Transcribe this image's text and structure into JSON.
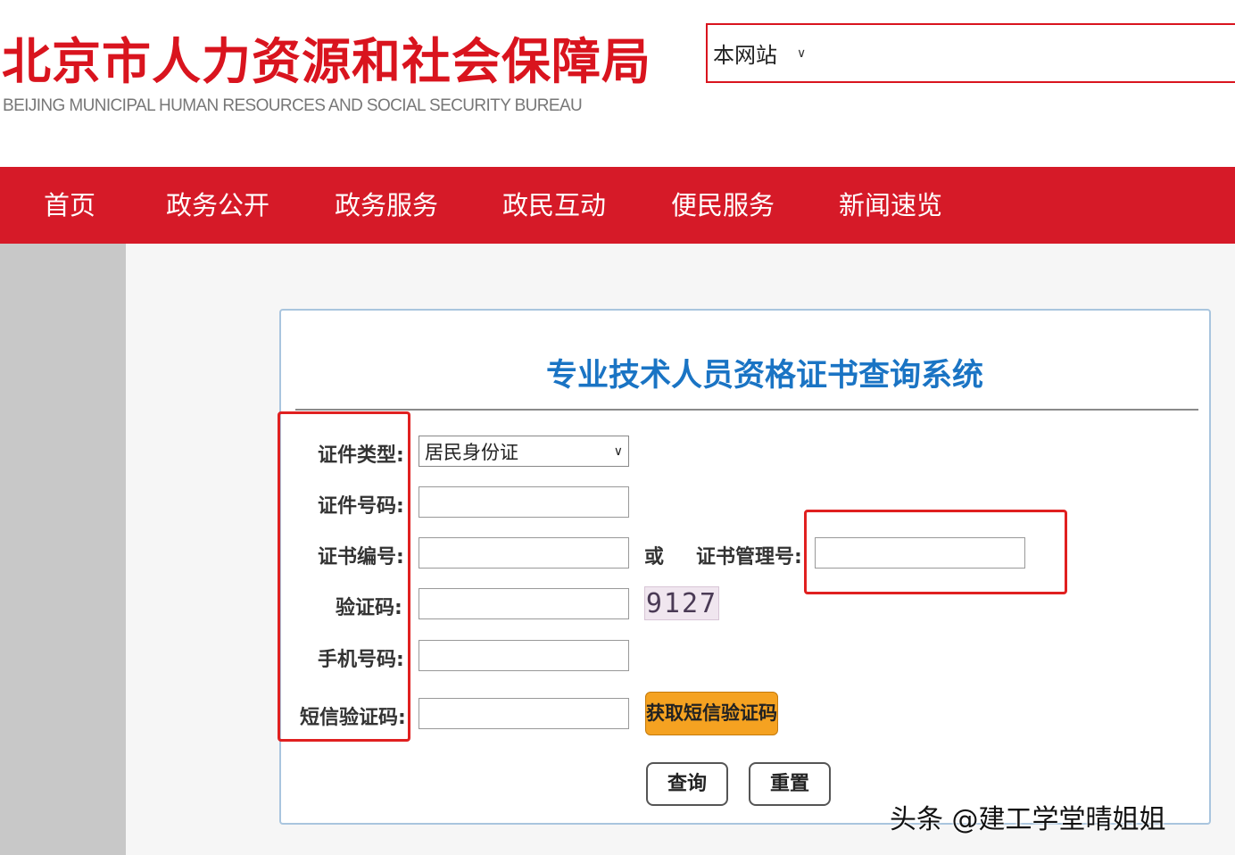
{
  "header": {
    "logo_cn": "北京市人力资源和社会保障局",
    "logo_en": "BEIJING MUNICIPAL HUMAN RESOURCES AND SOCIAL SECURITY BUREAU",
    "search_scope": "本网站"
  },
  "nav": {
    "items": [
      {
        "label": "首页"
      },
      {
        "label": "政务公开"
      },
      {
        "label": "政务服务"
      },
      {
        "label": "政民互动"
      },
      {
        "label": "便民服务"
      },
      {
        "label": "新闻速览"
      }
    ]
  },
  "form": {
    "title": "专业技术人员资格证书查询系统",
    "id_type_label": "证件类型:",
    "id_type_value": "居民身份证",
    "id_number_label": "证件号码:",
    "cert_number_label": "证书编号:",
    "or_text": "或",
    "cert_mgmt_label": "证书管理号:",
    "captcha_label": "验证码:",
    "captcha_text": "9127",
    "phone_label": "手机号码:",
    "sms_code_label": "短信验证码:",
    "sms_button": "获取短信验证码",
    "query_button": "查询",
    "reset_button": "重置"
  },
  "watermark": "头条 @建工学堂晴姐姐",
  "colors": {
    "brand_red": "#d61a28",
    "title_blue": "#1a74c4",
    "sms_orange": "#f5a221",
    "annotation_red": "#e02020"
  }
}
